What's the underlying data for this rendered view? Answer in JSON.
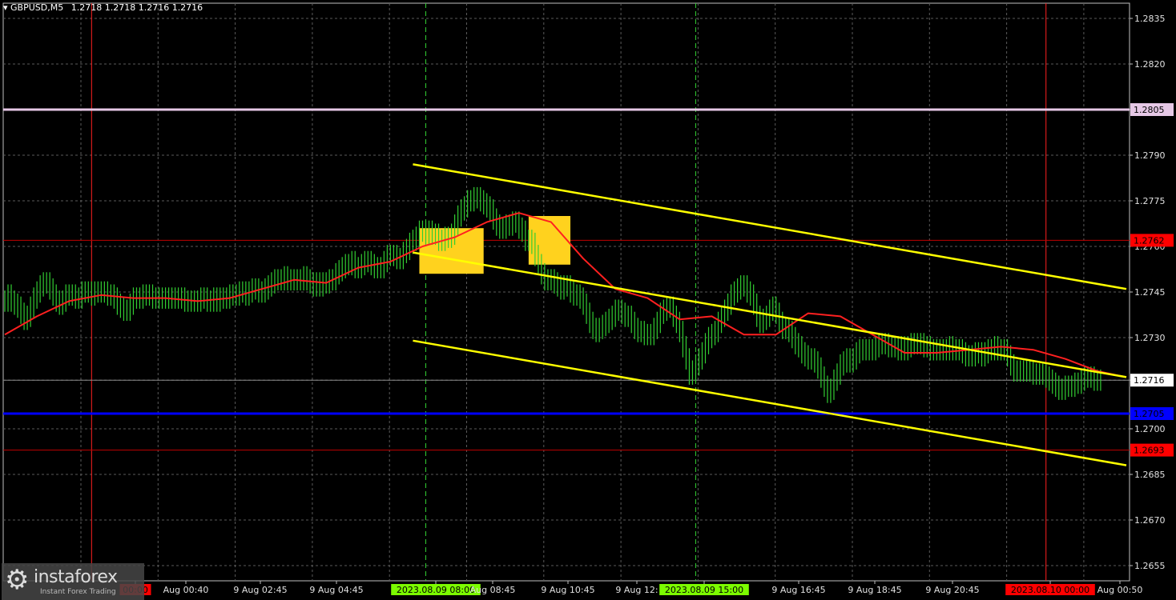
{
  "header": {
    "symbol": "GBPUSD,M5",
    "ohlc": "1.2718 1.2718 1.2716 1.2716"
  },
  "watermark": {
    "brand": "instaforex",
    "tagline": "Instant Forex Trading"
  },
  "colors": {
    "background": "#000000",
    "grid": "#5a5a5a",
    "candles": "#32cd32",
    "moving_average": "#ff2020",
    "channel": "#ffff00",
    "support_resistance": "#c00000",
    "blue_level": "#0000ff",
    "pink_level": "#e6c8e6",
    "signal_box": "#ffd21e"
  },
  "chart_data": {
    "type": "line",
    "title": "GBPUSD,M5",
    "ylim": [
      1.265,
      1.284
    ],
    "grid": true,
    "y_ticks": [
      "1.2835",
      "1.2820",
      "1.2805",
      "1.2790",
      "1.2775",
      "1.2760",
      "1.2745",
      "1.2730",
      "1.2716",
      "1.2700",
      "1.2685",
      "1.2670",
      "1.2655"
    ],
    "x_tick_labels": [
      "00:00",
      "Aug 00:40",
      "9 Aug 02:45",
      "9 Aug 04:45",
      "2023.08.09 08:00",
      "Aug 08:45",
      "9 Aug 10:45",
      "9 Aug 12:",
      "2023.08.09 15:00",
      "9 Aug 16:45",
      "9 Aug 18:45",
      "9 Aug 20:45",
      "2023.08.10 00:00",
      "Aug 00:50"
    ],
    "highlighted_x_labels": [
      {
        "text": "00:00",
        "color": "#ff0000"
      },
      {
        "text": "2023.08.09 08:00",
        "color": "#7cfc00"
      },
      {
        "text": "2023.08.09 15:00",
        "color": "#7cfc00"
      },
      {
        "text": "2023.08.10 00:00",
        "color": "#ff0000"
      }
    ],
    "price_levels": [
      {
        "value": 1.2805,
        "label": "1.2805",
        "style": "pink"
      },
      {
        "value": 1.2762,
        "label": "1.2762",
        "style": "red"
      },
      {
        "value": 1.2716,
        "label": "1.2716",
        "style": "current"
      },
      {
        "value": 1.2705,
        "label": "1.2705",
        "style": "blue"
      },
      {
        "value": 1.2693,
        "label": "1.2693",
        "style": "red"
      }
    ],
    "series": [
      {
        "type": "line",
        "x": [
          0,
          1,
          2,
          3,
          4,
          5,
          6,
          7,
          8,
          9,
          10,
          11,
          12,
          13,
          14,
          15,
          16,
          17,
          18,
          19,
          20,
          21,
          22,
          23,
          24,
          25,
          26,
          27,
          28,
          29,
          30,
          31,
          32,
          33,
          34,
          35,
          36,
          37,
          38,
          39,
          40,
          41,
          42,
          43,
          44,
          45,
          46,
          47,
          48,
          49,
          50,
          51,
          52,
          53,
          54,
          55,
          56,
          57,
          58,
          59,
          60,
          61,
          62,
          63,
          64,
          65,
          66,
          67,
          68,
          69,
          70,
          71,
          72,
          73,
          74,
          75,
          76,
          77,
          78,
          79,
          80,
          81,
          82,
          83,
          84,
          85,
          86,
          87,
          88,
          89,
          90,
          91,
          92,
          93,
          94,
          95,
          96,
          97,
          98,
          99,
          100,
          101,
          102,
          103,
          104,
          105,
          106,
          107,
          108,
          109,
          110,
          111,
          112,
          113,
          114,
          115,
          116,
          117,
          118,
          119,
          120,
          121,
          122,
          123,
          124,
          125,
          126,
          127,
          128,
          129,
          130,
          131,
          132,
          133,
          134,
          135,
          136,
          137,
          138,
          139,
          140,
          141,
          142,
          143,
          144,
          145,
          146,
          147,
          148,
          149,
          150,
          151,
          152,
          153,
          154,
          155,
          156,
          157,
          158,
          159,
          160,
          161,
          162,
          163,
          164,
          165,
          166,
          167,
          168,
          169,
          170,
          171,
          172,
          173,
          174,
          175,
          176,
          177,
          178,
          179,
          180,
          181,
          182,
          183,
          184,
          185,
          186,
          187,
          188,
          189,
          190,
          191,
          192,
          193,
          194,
          195,
          196,
          197,
          198,
          199,
          200,
          201,
          202,
          203,
          204,
          205,
          206,
          207,
          208,
          209,
          210,
          211,
          212,
          213,
          214,
          215,
          216,
          217,
          218,
          219,
          220,
          221,
          222,
          223,
          224,
          225,
          226,
          227,
          228,
          229,
          230,
          231,
          232,
          233,
          234,
          235,
          236,
          237,
          238,
          239,
          240,
          241,
          242,
          243,
          244,
          245,
          246,
          247,
          248,
          249,
          250,
          251,
          252,
          253,
          254,
          255,
          256,
          257,
          258,
          259,
          260,
          261,
          262,
          263,
          264,
          265,
          266,
          267,
          268,
          269,
          270,
          271,
          272,
          273,
          274,
          275,
          276,
          277,
          278,
          279,
          280,
          281,
          282,
          283,
          284,
          285,
          286,
          287,
          288,
          289,
          290,
          291,
          292,
          293,
          294,
          295,
          296,
          297,
          298,
          299,
          300,
          301,
          302,
          303,
          304,
          305,
          306,
          307,
          308,
          309,
          310,
          311,
          312,
          313,
          314,
          315,
          316,
          317,
          318,
          319,
          320,
          321,
          322,
          323,
          324,
          325,
          326,
          327,
          328,
          329,
          330,
          331,
          332,
          333,
          334,
          335,
          336,
          337,
          338,
          339,
          340,
          341,
          342,
          343,
          344,
          345,
          346,
          347,
          348,
          349
        ],
        "close": [
          1.2742,
          1.2744,
          1.2742,
          1.2741,
          1.274,
          1.2738,
          1.2736,
          1.2737,
          1.274,
          1.2743,
          1.2745,
          1.2747,
          1.2748,
          1.2748,
          1.2746,
          1.2744,
          1.2742,
          1.2741,
          1.2742,
          1.2744,
          1.2744,
          1.2744,
          1.2743,
          1.2743,
          1.2745,
          1.2745,
          1.2745,
          1.2744,
          1.2745,
          1.2745,
          1.2745,
          1.2745,
          1.2744,
          1.2744,
          1.2743,
          1.2741,
          1.274,
          1.2739,
          1.2739,
          1.2741,
          1.2743,
          1.2743,
          1.2743,
          1.2744,
          1.2744,
          1.2744,
          1.2743,
          1.2743,
          1.2743,
          1.2743,
          1.2743,
          1.2743,
          1.2743,
          1.2743,
          1.2743,
          1.2743,
          1.2742,
          1.2742,
          1.2742,
          1.2742,
          1.2742,
          1.2743,
          1.2743,
          1.2742,
          1.2742,
          1.2743,
          1.2742,
          1.2743,
          1.2743,
          1.2743,
          1.2744,
          1.2744,
          1.2744,
          1.2745,
          1.2745,
          1.2744,
          1.2745,
          1.2746,
          1.2746,
          1.2745,
          1.2745,
          1.2746,
          1.2747,
          1.2748,
          1.2749,
          1.2749,
          1.2749,
          1.275,
          1.2749,
          1.2749,
          1.2749,
          1.2749,
          1.2749,
          1.275,
          1.2749,
          1.2748,
          1.2747,
          1.2748,
          1.2747,
          1.2748,
          1.2748,
          1.2749,
          1.2749,
          1.2751,
          1.2752,
          1.2753,
          1.2754,
          1.2754,
          1.2755,
          1.2753,
          1.2753,
          1.2754,
          1.2755,
          1.2755,
          1.2754,
          1.2753,
          1.2753,
          1.2753,
          1.2755,
          1.2757,
          1.2757,
          1.2757,
          1.2756,
          1.2756,
          1.2758,
          1.2759,
          1.2761,
          1.2762,
          1.2763,
          1.2765,
          1.2765,
          1.2764,
          1.2765,
          1.2764,
          1.2764,
          1.2762,
          1.2762,
          1.2763,
          1.2763,
          1.2764,
          1.2767,
          1.277,
          1.2772,
          1.2773,
          1.2775,
          1.2775,
          1.2776,
          1.2776,
          1.2775,
          1.2774,
          1.2773,
          1.2772,
          1.2769,
          1.2767,
          1.2766,
          1.2766,
          1.2767,
          1.2767,
          1.2768,
          1.2768,
          1.2766,
          1.2765,
          1.2762,
          1.2762,
          1.2761,
          1.2757,
          1.2754,
          1.2751,
          1.2749,
          1.2749,
          1.2749,
          1.2748,
          1.2747,
          1.2746,
          1.2747,
          1.2747,
          1.2745,
          1.2744,
          1.2744,
          1.2743,
          1.2741,
          1.2738,
          1.2735,
          1.2733,
          1.2732,
          1.2733,
          1.2734,
          1.2735,
          1.2736,
          1.2737,
          1.2739,
          1.2739,
          1.2738,
          1.2737,
          1.2737,
          1.2735,
          1.2733,
          1.2732,
          1.2732,
          1.2731,
          1.2731,
          1.2731,
          1.2733,
          1.2735,
          1.2738,
          1.2739,
          1.274,
          1.274,
          1.2737,
          1.2735,
          1.2732,
          1.2727,
          1.2723,
          1.2718,
          1.2719,
          1.2721,
          1.2723,
          1.2725,
          1.2728,
          1.273,
          1.2731,
          1.2732,
          1.2735,
          1.2737,
          1.2739,
          1.2741,
          1.2744,
          1.2745,
          1.2746,
          1.2747,
          1.2747,
          1.2745,
          1.2744,
          1.2741,
          1.2737,
          1.2735,
          1.2736,
          1.2737,
          1.2739,
          1.274,
          1.2738,
          1.2735,
          1.2733,
          1.2733,
          1.2732,
          1.273,
          1.2728,
          1.2727,
          1.2725,
          1.2724,
          1.2723,
          1.2723,
          1.2722,
          1.272,
          1.2717,
          1.2714,
          1.2712,
          1.2713,
          1.2716,
          1.2718,
          1.2721,
          1.2722,
          1.2723,
          1.2722,
          1.2723,
          1.2725,
          1.2726,
          1.2726,
          1.2726,
          1.2726,
          1.2726,
          1.2727,
          1.2728,
          1.2728,
          1.2728,
          1.2727,
          1.2727,
          1.2727,
          1.2726,
          1.2727,
          1.2726,
          1.2727,
          1.2728,
          1.2728,
          1.2728,
          1.2728,
          1.2727,
          1.2727,
          1.2726,
          1.2726,
          1.2726,
          1.2726,
          1.2726,
          1.2726,
          1.2727,
          1.2726,
          1.2726,
          1.2726,
          1.2725,
          1.2724,
          1.2724,
          1.2724,
          1.2725,
          1.2725,
          1.2724,
          1.2725,
          1.2726,
          1.2726,
          1.2727,
          1.2726,
          1.2726,
          1.2726,
          1.2724,
          1.2721,
          1.2719,
          1.2719,
          1.2719,
          1.2719,
          1.2719,
          1.2719,
          1.2718,
          1.2718,
          1.2718,
          1.2718,
          1.2717,
          1.2716,
          1.2715,
          1.2714,
          1.2713,
          1.2713,
          1.2714,
          1.2714,
          1.2714,
          1.2715,
          1.2715,
          1.2716,
          1.2717,
          1.2717,
          1.2717,
          1.2716,
          1.2716,
          1.2716
        ]
      },
      {
        "type": "line",
        "x": [
          0,
          10,
          20,
          30,
          40,
          50,
          60,
          70,
          80,
          90,
          100,
          110,
          120,
          130,
          140,
          150,
          160,
          170,
          180,
          190,
          200,
          210,
          220,
          230,
          240,
          250,
          260,
          270,
          280,
          290,
          300,
          310,
          320,
          330,
          340,
          349
        ],
        "values": [
          1.2731,
          1.2737,
          1.2742,
          1.2744,
          1.2743,
          1.2743,
          1.2742,
          1.2743,
          1.2746,
          1.2749,
          1.2748,
          1.2753,
          1.2755,
          1.276,
          1.2763,
          1.2768,
          1.2771,
          1.2768,
          1.2756,
          1.2746,
          1.2743,
          1.2736,
          1.2737,
          1.2731,
          1.2731,
          1.2738,
          1.2737,
          1.2731,
          1.2725,
          1.2725,
          1.2726,
          1.2727,
          1.2726,
          1.2723,
          1.2719,
          1.2717
        ]
      },
      {
        "type": "line",
        "x": [
          127,
          349
        ],
        "values": [
          1.2787,
          1.2746
        ]
      },
      {
        "type": "line",
        "x": [
          127,
          349
        ],
        "values": [
          1.2758,
          1.2717
        ]
      },
      {
        "type": "line",
        "x": [
          127,
          349
        ],
        "values": [
          1.2729,
          1.2688
        ]
      }
    ],
    "annotations": [
      {
        "type": "box",
        "x": [
          129,
          149
        ],
        "y": [
          1.2766,
          1.2751
        ]
      },
      {
        "type": "box",
        "x": [
          163,
          176
        ],
        "y": [
          1.277,
          1.2754
        ]
      }
    ]
  }
}
